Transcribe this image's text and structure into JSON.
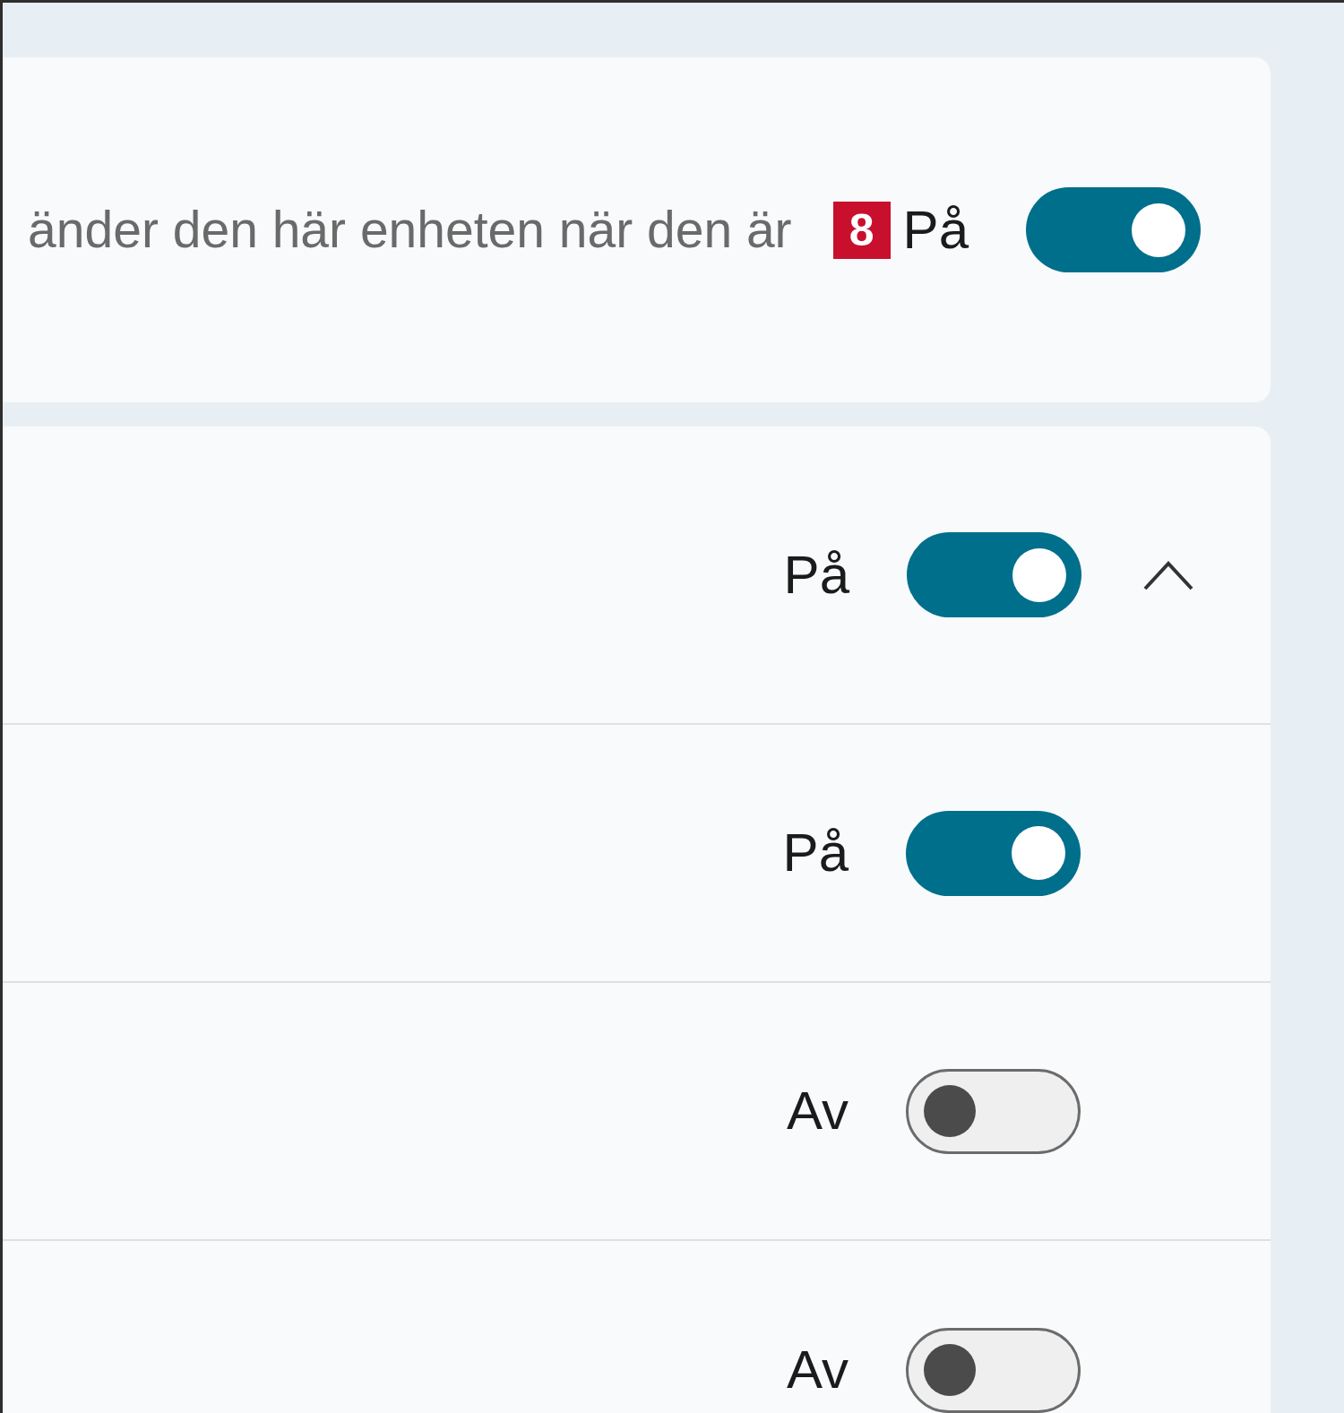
{
  "cards": [
    {
      "rows": [
        {
          "description": "änder den här enheten när den är",
          "badge": "8",
          "state_label": "På",
          "on": true
        }
      ]
    },
    {
      "expanded": true,
      "header": {
        "state_label": "På",
        "on": true
      },
      "rows": [
        {
          "state_label": "På",
          "on": true
        },
        {
          "state_label": "Av",
          "on": false
        },
        {
          "state_label": "Av",
          "on": false
        }
      ]
    }
  ]
}
